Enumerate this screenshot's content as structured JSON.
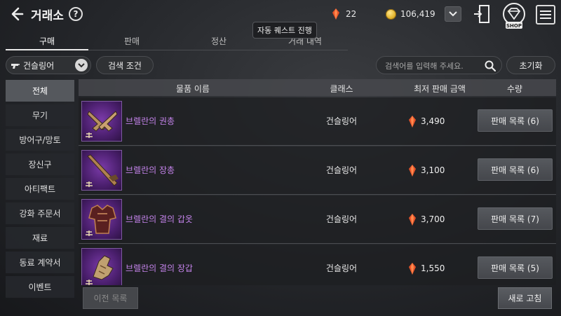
{
  "header": {
    "title": "거래소",
    "help_symbol": "?",
    "currency_gem": "22",
    "currency_gold": "106,419",
    "icons": [
      "back-arrow-icon",
      "help-icon",
      "gem-icon",
      "gold-coin-icon",
      "chevron-down-icon",
      "exit-door-icon",
      "shop-icon",
      "hamburger-menu-icon"
    ],
    "shop_label": "SHOP"
  },
  "tabs": [
    {
      "label": "구매",
      "active": true
    },
    {
      "label": "판매",
      "active": false
    },
    {
      "label": "정산",
      "active": false
    },
    {
      "label": "거래 내역",
      "active": false
    }
  ],
  "tooltip": "자동 퀘스트 진행",
  "filters": {
    "class_value": "건슬링어",
    "search_condition": "검색 조건",
    "search_placeholder": "검색어를 입력해 주세요.",
    "reset": "초기화"
  },
  "sidebar": [
    {
      "label": "전체",
      "active": true
    },
    {
      "label": "무기"
    },
    {
      "label": "방어구/망토"
    },
    {
      "label": "장신구"
    },
    {
      "label": "아티팩트"
    },
    {
      "label": "강화 주문서"
    },
    {
      "label": "재료"
    },
    {
      "label": "동료 계약서"
    },
    {
      "label": "이벤트"
    }
  ],
  "table": {
    "columns": [
      "물품 이름",
      "클래스",
      "최저 판매 금액",
      "수량"
    ],
    "rows": [
      {
        "name": "브렐란의 권총",
        "class": "건슬링어",
        "price": "3,490",
        "listing": "판매 목록 (6)"
      },
      {
        "name": "브렐란의 장총",
        "class": "건슬링어",
        "price": "3,100",
        "listing": "판매 목록 (6)"
      },
      {
        "name": "브렐란의 결의 갑옷",
        "class": "건슬링어",
        "price": "3,700",
        "listing": "판매 목록 (7)"
      },
      {
        "name": "브렐란의 결의 장갑",
        "class": "건슬링어",
        "price": "1,550",
        "listing": "판매 목록 (5)"
      }
    ]
  },
  "footer": {
    "prev": "이전 목록",
    "refresh": "새로 고침"
  },
  "colors": {
    "item_name": "#c584ec",
    "gem": "#e8542a",
    "rarity_bg": "#5a2a85"
  }
}
